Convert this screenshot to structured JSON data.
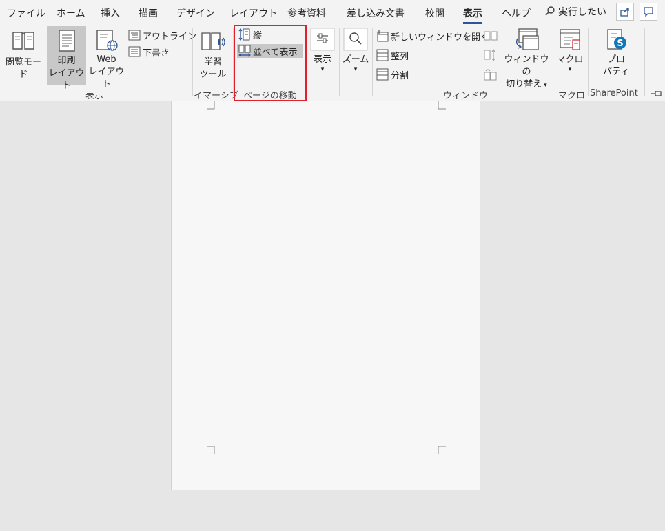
{
  "tabs": [
    "ファイル",
    "ホーム",
    "挿入",
    "描画",
    "デザイン",
    "レイアウト",
    "参考資料",
    "差し込み文書",
    "校閲",
    "表示",
    "ヘルプ"
  ],
  "search_text": "実行したい",
  "ribbon": {
    "views": {
      "read_mode": "閲覧モード",
      "print_layout_l1": "印刷",
      "print_layout_l2": "レイアウト",
      "web_layout_l1": "Web",
      "web_layout_l2": "レイアウト",
      "outline": "アウトライン",
      "draft": "下書き",
      "group_label": "表示"
    },
    "immersive": {
      "learning_l1": "学習",
      "learning_l2": "ツール",
      "group_label": "イマーシブ"
    },
    "page_movement": {
      "vertical": "縦",
      "side_by_side": "並べて表示",
      "group_label": "ページの移動"
    },
    "show": {
      "label": "表示"
    },
    "zoom": {
      "label": "ズーム"
    },
    "window": {
      "new_window": "新しいウィンドウを開く",
      "arrange_all": "整列",
      "split": "分割",
      "switch_l1": "ウィンドウの",
      "switch_l2": "切り替え",
      "group_label": "ウィンドウ"
    },
    "macros": {
      "label": "マクロ",
      "group_label": "マクロ"
    },
    "sharepoint": {
      "properties_l1": "プロ",
      "properties_l2": "パティ",
      "group_label": "SharePoint"
    }
  },
  "colors": {
    "accent": "#2b579a",
    "highlight_frame": "#e0202a"
  }
}
